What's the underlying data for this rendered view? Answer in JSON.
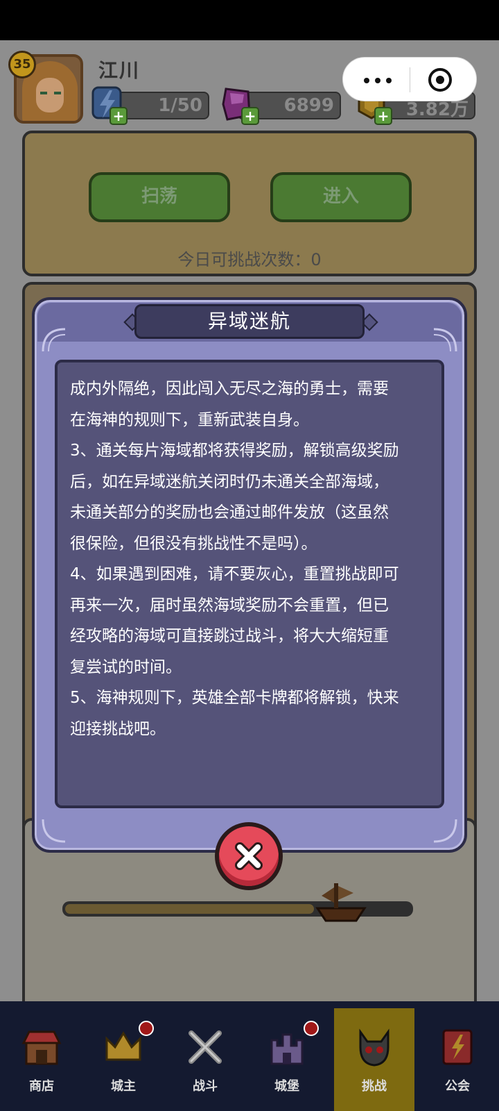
{
  "player": {
    "level": "35",
    "name": "江川"
  },
  "resources": {
    "energy": "1/50",
    "gems": "6899",
    "coins": "3.82万"
  },
  "top_card": {
    "sweep_label": "扫荡",
    "enter_label": "进入"
  },
  "challenge": {
    "today_count": "今日可挑战次数：0"
  },
  "progress": {
    "fraction": 0.72
  },
  "dialog": {
    "title": "异域迷航",
    "lines": [
      "成内外隔绝，因此闯入无尽之海的勇士，需要",
      "在海神的规则下，重新武装自身。",
      "3、通关每片海域都将获得奖励，解锁高级奖励",
      "后，如在异域迷航关闭时仍未通关全部海域，",
      "未通关部分的奖励也会通过邮件发放（这虽然",
      "很保险，但很没有挑战性不是吗）。",
      "4、如果遇到困难，请不要灰心，重置挑战即可",
      "再来一次，届时虽然海域奖励不会重置，但已",
      "经攻略的海域可直接跳过战斗，将大大缩短重",
      "复尝试的时间。",
      "5、海神规则下，英雄全部卡牌都将解锁，快来",
      "迎接挑战吧。"
    ]
  },
  "nav": [
    {
      "label": "商店"
    },
    {
      "label": "城主"
    },
    {
      "label": "战斗"
    },
    {
      "label": "城堡"
    },
    {
      "label": "挑战"
    },
    {
      "label": "公会"
    }
  ],
  "colors": {
    "close_button": "#e54a5a",
    "dialog_bg": "#8d8dc4",
    "content_bg": "#555379",
    "nav_active": "#7e6a10"
  }
}
